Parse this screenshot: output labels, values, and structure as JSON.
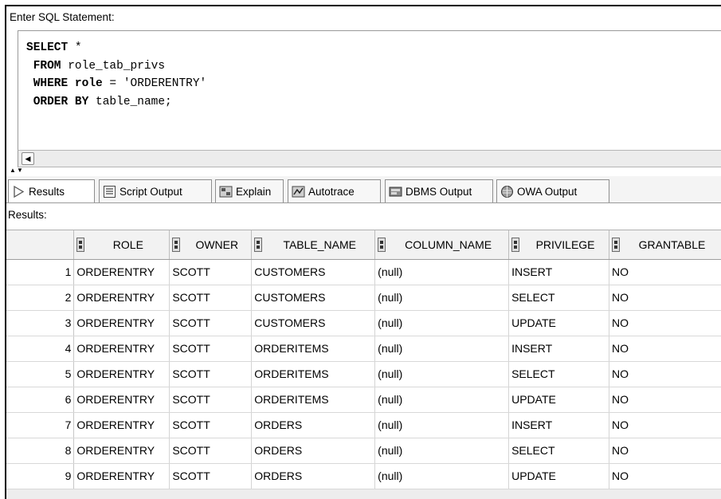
{
  "editor": {
    "label": "Enter SQL Statement:",
    "lines": [
      {
        "kw": "SELECT",
        "rest": " *"
      },
      {
        "kw": " FROM",
        "rest": " role_tab_privs"
      },
      {
        "kw": " WHERE",
        "rest": "",
        "kw2": "role",
        "rest2": " = 'ORDERENTRY'"
      },
      {
        "kw": " ORDER BY",
        "rest": " table_name;"
      }
    ]
  },
  "tabs": [
    {
      "label": "Results",
      "icon": "play-icon"
    },
    {
      "label": "Script Output",
      "icon": "script-icon"
    },
    {
      "label": "Explain",
      "icon": "explain-icon"
    },
    {
      "label": "Autotrace",
      "icon": "autotrace-icon"
    },
    {
      "label": "DBMS Output",
      "icon": "dbms-icon"
    },
    {
      "label": "OWA Output",
      "icon": "owa-icon"
    }
  ],
  "results_label": "Results:",
  "columns": [
    "ROLE",
    "OWNER",
    "TABLE_NAME",
    "COLUMN_NAME",
    "PRIVILEGE",
    "GRANTABLE"
  ],
  "rows": [
    [
      "1",
      "ORDERENTRY",
      "SCOTT",
      "CUSTOMERS",
      "(null)",
      "INSERT",
      "NO"
    ],
    [
      "2",
      "ORDERENTRY",
      "SCOTT",
      "CUSTOMERS",
      "(null)",
      "SELECT",
      "NO"
    ],
    [
      "3",
      "ORDERENTRY",
      "SCOTT",
      "CUSTOMERS",
      "(null)",
      "UPDATE",
      "NO"
    ],
    [
      "4",
      "ORDERENTRY",
      "SCOTT",
      "ORDERITEMS",
      "(null)",
      "INSERT",
      "NO"
    ],
    [
      "5",
      "ORDERENTRY",
      "SCOTT",
      "ORDERITEMS",
      "(null)",
      "SELECT",
      "NO"
    ],
    [
      "6",
      "ORDERENTRY",
      "SCOTT",
      "ORDERITEMS",
      "(null)",
      "UPDATE",
      "NO"
    ],
    [
      "7",
      "ORDERENTRY",
      "SCOTT",
      "ORDERS",
      "(null)",
      "INSERT",
      "NO"
    ],
    [
      "8",
      "ORDERENTRY",
      "SCOTT",
      "ORDERS",
      "(null)",
      "SELECT",
      "NO"
    ],
    [
      "9",
      "ORDERENTRY",
      "SCOTT",
      "ORDERS",
      "(null)",
      "UPDATE",
      "NO"
    ]
  ]
}
